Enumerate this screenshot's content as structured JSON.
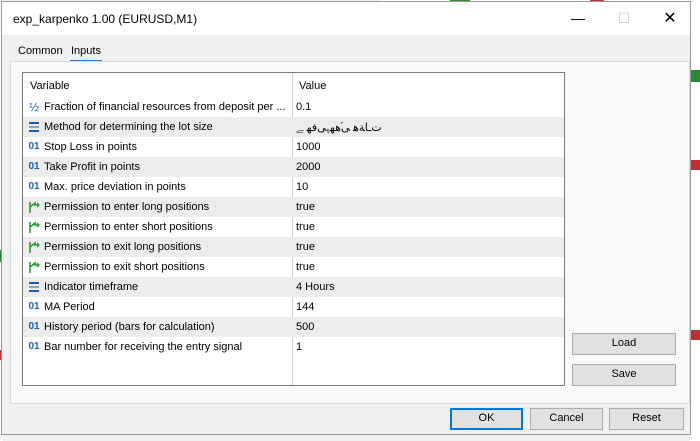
{
  "window": {
    "title": "exp_karpenko 1.00 (EURUSD,M1)",
    "minimize_glyph": "—",
    "maximize_glyph": "☐",
    "close_glyph": "✕"
  },
  "tabs": [
    {
      "label": "Common",
      "active": false
    },
    {
      "label": "Inputs",
      "active": true
    }
  ],
  "grid": {
    "columns": {
      "variable": "Variable",
      "value": "Value"
    },
    "rows": [
      {
        "icon": "fraction-icon",
        "name": "Fraction of financial resources from deposit per ...",
        "value": "0.1"
      },
      {
        "icon": "enum-icon",
        "name": "Method for determining the lot size",
        "value": "ﺕـاﺔﻫ ﯽ֝ﻫﮭﮩﯽﻓﻬ ﮯ"
      },
      {
        "icon": "integer-icon",
        "name": "Stop Loss in points",
        "value": "1000"
      },
      {
        "icon": "integer-icon",
        "name": "Take Profit in points",
        "value": "2000"
      },
      {
        "icon": "integer-icon",
        "name": "Max. price deviation in points",
        "value": "10"
      },
      {
        "icon": "boolean-icon",
        "name": "Permission to enter long positions",
        "value": "true"
      },
      {
        "icon": "boolean-icon",
        "name": "Permission to enter short positions",
        "value": "true"
      },
      {
        "icon": "boolean-icon",
        "name": "Permission to exit long positions",
        "value": "true"
      },
      {
        "icon": "boolean-icon",
        "name": "Permission to exit short positions",
        "value": "true"
      },
      {
        "icon": "enum-icon",
        "name": "Indicator timeframe",
        "value": "4 Hours"
      },
      {
        "icon": "integer-icon",
        "name": "MA Period",
        "value": "144"
      },
      {
        "icon": "integer-icon",
        "name": "History period (bars for calculation)",
        "value": "500"
      },
      {
        "icon": "integer-icon",
        "name": "Bar number for receiving the entry signal",
        "value": "1"
      }
    ]
  },
  "side_buttons": {
    "load": "Load",
    "save": "Save"
  },
  "footer_buttons": {
    "ok": "OK",
    "cancel": "Cancel",
    "reset": "Reset"
  },
  "icon_glyphs": {
    "integer": "01",
    "fraction": "½",
    "enum": "≡"
  },
  "colors": {
    "accent": "#0078d7",
    "tab_underline": "#2a7fd4",
    "icon_blue": "#1a5fb4",
    "icon_green": "#2e9a2e"
  }
}
